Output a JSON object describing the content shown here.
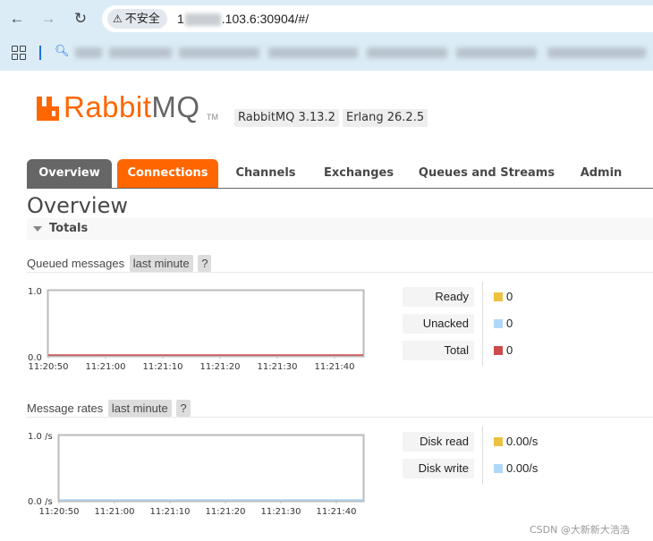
{
  "browser": {
    "security_label": "不安全",
    "url_prefix": "1",
    "url_suffix": ".103.6:30904/#/"
  },
  "app": {
    "logo_rabbit": "Rabbit",
    "logo_mq": "MQ",
    "logo_tm": "TM",
    "rabbitmq_version": "RabbitMQ 3.13.2",
    "erlang_version": "Erlang 26.2.5"
  },
  "tabs": [
    {
      "label": "Overview"
    },
    {
      "label": "Connections"
    },
    {
      "label": "Channels"
    },
    {
      "label": "Exchanges"
    },
    {
      "label": "Queues and Streams"
    },
    {
      "label": "Admin"
    }
  ],
  "page": {
    "title": "Overview",
    "section": "Totals"
  },
  "queued": {
    "title": "Queued messages",
    "range": "last minute",
    "help": "?",
    "y_top": "1.0",
    "y_bottom": "0.0",
    "x_ticks": [
      "11:20:50",
      "11:21:00",
      "11:21:10",
      "11:21:20",
      "11:21:30",
      "11:21:40"
    ],
    "legend": [
      {
        "label": "Ready",
        "value": "0",
        "color": "#edc240"
      },
      {
        "label": "Unacked",
        "value": "0",
        "color": "#afd8f8"
      },
      {
        "label": "Total",
        "value": "0",
        "color": "#cb4b4b"
      }
    ]
  },
  "rates": {
    "title": "Message rates",
    "range": "last minute",
    "help": "?",
    "y_top": "1.0 /s",
    "y_bottom": "0.0 /s",
    "x_ticks": [
      "11:20:50",
      "11:21:00",
      "11:21:10",
      "11:21:20",
      "11:21:30",
      "11:21:40"
    ],
    "legend": [
      {
        "label": "Disk read",
        "value": "0.00/s",
        "color": "#edc240"
      },
      {
        "label": "Disk write",
        "value": "0.00/s",
        "color": "#afd8f8"
      }
    ]
  },
  "watermark": "CSDN @大新新大浩浩"
}
